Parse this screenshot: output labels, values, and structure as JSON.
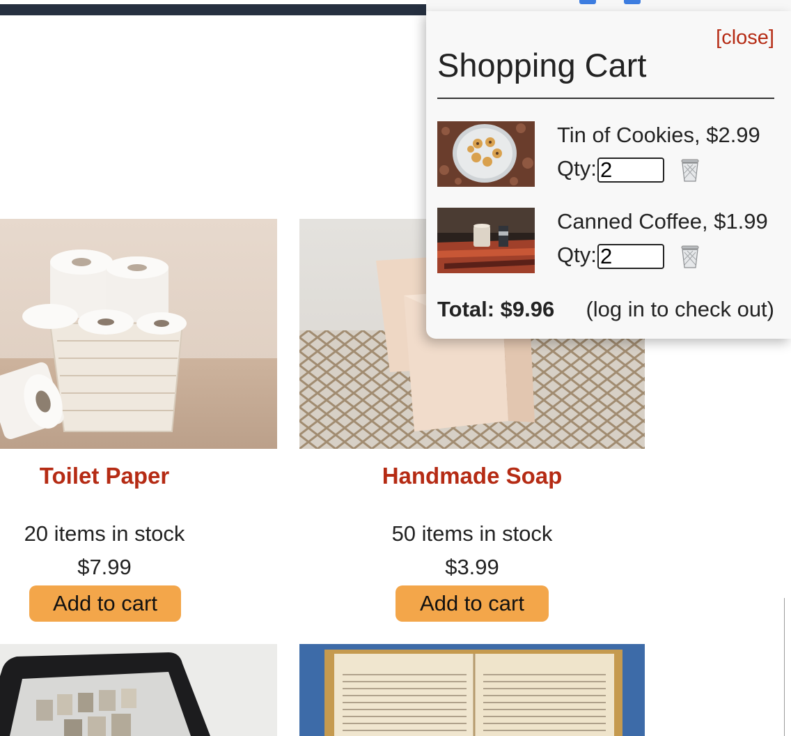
{
  "cart": {
    "close_label": "[close]",
    "title": "Shopping Cart",
    "items": [
      {
        "name": "Tin of Cookies, $2.99",
        "qty_label": "Qty:",
        "qty": "2"
      },
      {
        "name": "Canned Coffee, $1.99",
        "qty_label": "Qty:",
        "qty": "2"
      }
    ],
    "total": "Total: $9.96",
    "checkout_note": "(log in to check out)"
  },
  "products": [
    {
      "title": "Toilet Paper",
      "stock": "20 items in stock",
      "price": "$7.99",
      "button": "Add to cart"
    },
    {
      "title": "Handmade Soap",
      "stock": "50 items in stock",
      "price": "$3.99",
      "button": "Add to cart"
    }
  ],
  "icons": {
    "trash": "trash-can-icon"
  },
  "colors": {
    "accent": "#b52b14",
    "button": "#f3a64a",
    "nav": "#263040"
  }
}
